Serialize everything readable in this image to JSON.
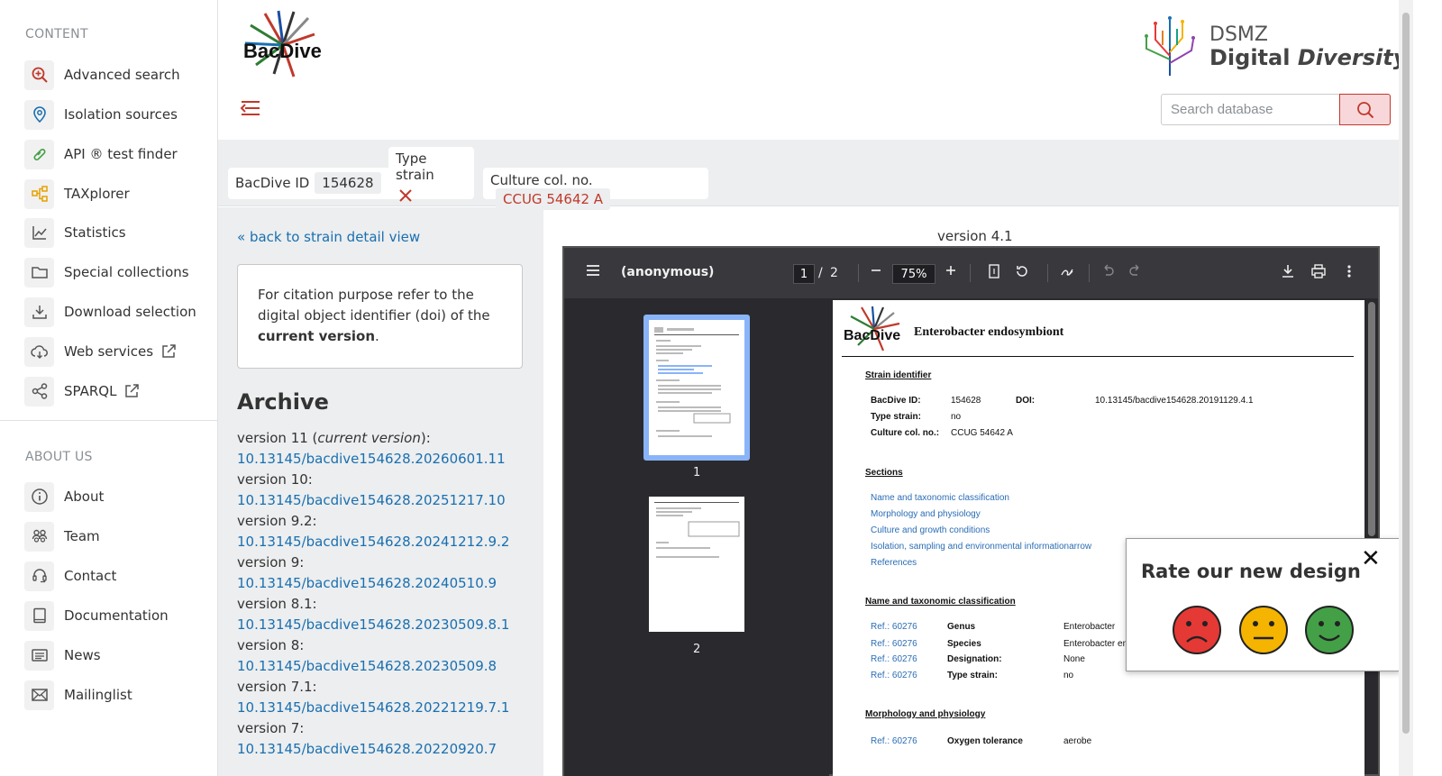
{
  "sidebar": {
    "content_heading": "CONTENT",
    "content_items": [
      {
        "label": "Advanced search",
        "icon": "magnifier-plus-icon"
      },
      {
        "label": "Isolation sources",
        "icon": "map-pin-icon"
      },
      {
        "label": "API ® test finder",
        "icon": "test-tube-icon"
      },
      {
        "label": "TAXplorer",
        "icon": "tree-icon"
      },
      {
        "label": "Statistics",
        "icon": "line-chart-icon"
      },
      {
        "label": "Special collections",
        "icon": "folder-icon"
      },
      {
        "label": "Download selection",
        "icon": "download-icon"
      },
      {
        "label": "Web services",
        "icon": "cloud-icon"
      },
      {
        "label": "SPARQL",
        "icon": "share-nodes-icon"
      }
    ],
    "about_heading": "ABOUT US",
    "about_items": [
      {
        "label": "About",
        "icon": "info-icon"
      },
      {
        "label": "Team",
        "icon": "team-icon"
      },
      {
        "label": "Contact",
        "icon": "headset-icon"
      },
      {
        "label": "Documentation",
        "icon": "book-icon"
      },
      {
        "label": "News",
        "icon": "newspaper-icon"
      },
      {
        "label": "Mailinglist",
        "icon": "envelope-icon"
      }
    ]
  },
  "header": {
    "logo_text": "BacDive",
    "dsmz_line1": "DSMZ",
    "dsmz_line2a": "Digital",
    "dsmz_line2b": "Diversity",
    "search_placeholder": "Search database"
  },
  "strain": {
    "bacdive_label": "BacDive ID",
    "bacdive_id": "154628",
    "type_strain_label": "Type strain",
    "culture_label": "Culture col. no.",
    "culture_value": "CCUG 54642 A"
  },
  "left": {
    "back_link": "« back to strain detail view",
    "cite_text1": "For citation purpose refer to the digital object identifier (doi) of the ",
    "cite_bold": "current version",
    "cite_text2": ".",
    "archive_title": "Archive",
    "versions": [
      {
        "label": "version 11 (",
        "italic": "current version",
        "suffix": "):",
        "doi": "10.13145/bacdive154628.20260601.11"
      },
      {
        "label": "version 10:",
        "italic": "",
        "suffix": "",
        "doi": "10.13145/bacdive154628.20251217.10"
      },
      {
        "label": "version 9.2:",
        "italic": "",
        "suffix": "",
        "doi": "10.13145/bacdive154628.20241212.9.2"
      },
      {
        "label": "version 9:",
        "italic": "",
        "suffix": "",
        "doi": "10.13145/bacdive154628.20240510.9"
      },
      {
        "label": "version 8.1:",
        "italic": "",
        "suffix": "",
        "doi": "10.13145/bacdive154628.20230509.8.1"
      },
      {
        "label": "version 8:",
        "italic": "",
        "suffix": "",
        "doi": "10.13145/bacdive154628.20230509.8"
      },
      {
        "label": "version 7.1:",
        "italic": "",
        "suffix": "",
        "doi": "10.13145/bacdive154628.20221219.7.1"
      },
      {
        "label": "version 7:",
        "italic": "",
        "suffix": "",
        "doi": "10.13145/bacdive154628.20220920.7"
      }
    ]
  },
  "viewer": {
    "version_label": "version 4.1",
    "doc_title": "(anonymous)",
    "page_current": "1",
    "page_sep": "/",
    "page_total": "2",
    "zoom": "75%",
    "thumb1_num": "1",
    "thumb2_num": "2"
  },
  "pdf": {
    "title": "Enterobacter endosymbiont",
    "strain_identifier_heading": "Strain identifier",
    "bacdive_id_label": "BacDive ID:",
    "bacdive_id_value": "154628",
    "doi_label": "DOI:",
    "doi_value": "10.13145/bacdive154628.20191129.4.1",
    "type_strain_label": "Type strain:",
    "type_strain_value": "no",
    "culture_label": "Culture col. no.:",
    "culture_value": "CCUG 54642 A",
    "sections_heading": "Sections",
    "sections": [
      "Name and taxonomic classification",
      "Morphology and physiology",
      "Culture and growth conditions",
      "Isolation, sampling and environmental informationarrow",
      "References"
    ],
    "taxonomy_heading": "Name and taxonomic classification",
    "taxonomy_rows": [
      {
        "ref": "Ref.: 60276",
        "key": "Genus",
        "value": "Enterobacter"
      },
      {
        "ref": "Ref.: 60276",
        "key": "Species",
        "value": "Enterobacter en"
      },
      {
        "ref": "Ref.: 60276",
        "key": "Designation:",
        "value": "None"
      },
      {
        "ref": "Ref.: 60276",
        "key": "Type strain:",
        "value": "no"
      }
    ],
    "morphology_heading": "Morphology and physiology",
    "morphology_rows": [
      {
        "ref": "Ref.: 60276",
        "key": "Oxygen tolerance",
        "value": "aerobe"
      }
    ]
  },
  "rate": {
    "title": "Rate our new design",
    "close": "✕"
  },
  "colors": {
    "link": "#1a6fb0",
    "accent_red": "#c0392b",
    "face_sad": "#e53935",
    "face_neutral": "#f4b400",
    "face_happy": "#43a047"
  }
}
